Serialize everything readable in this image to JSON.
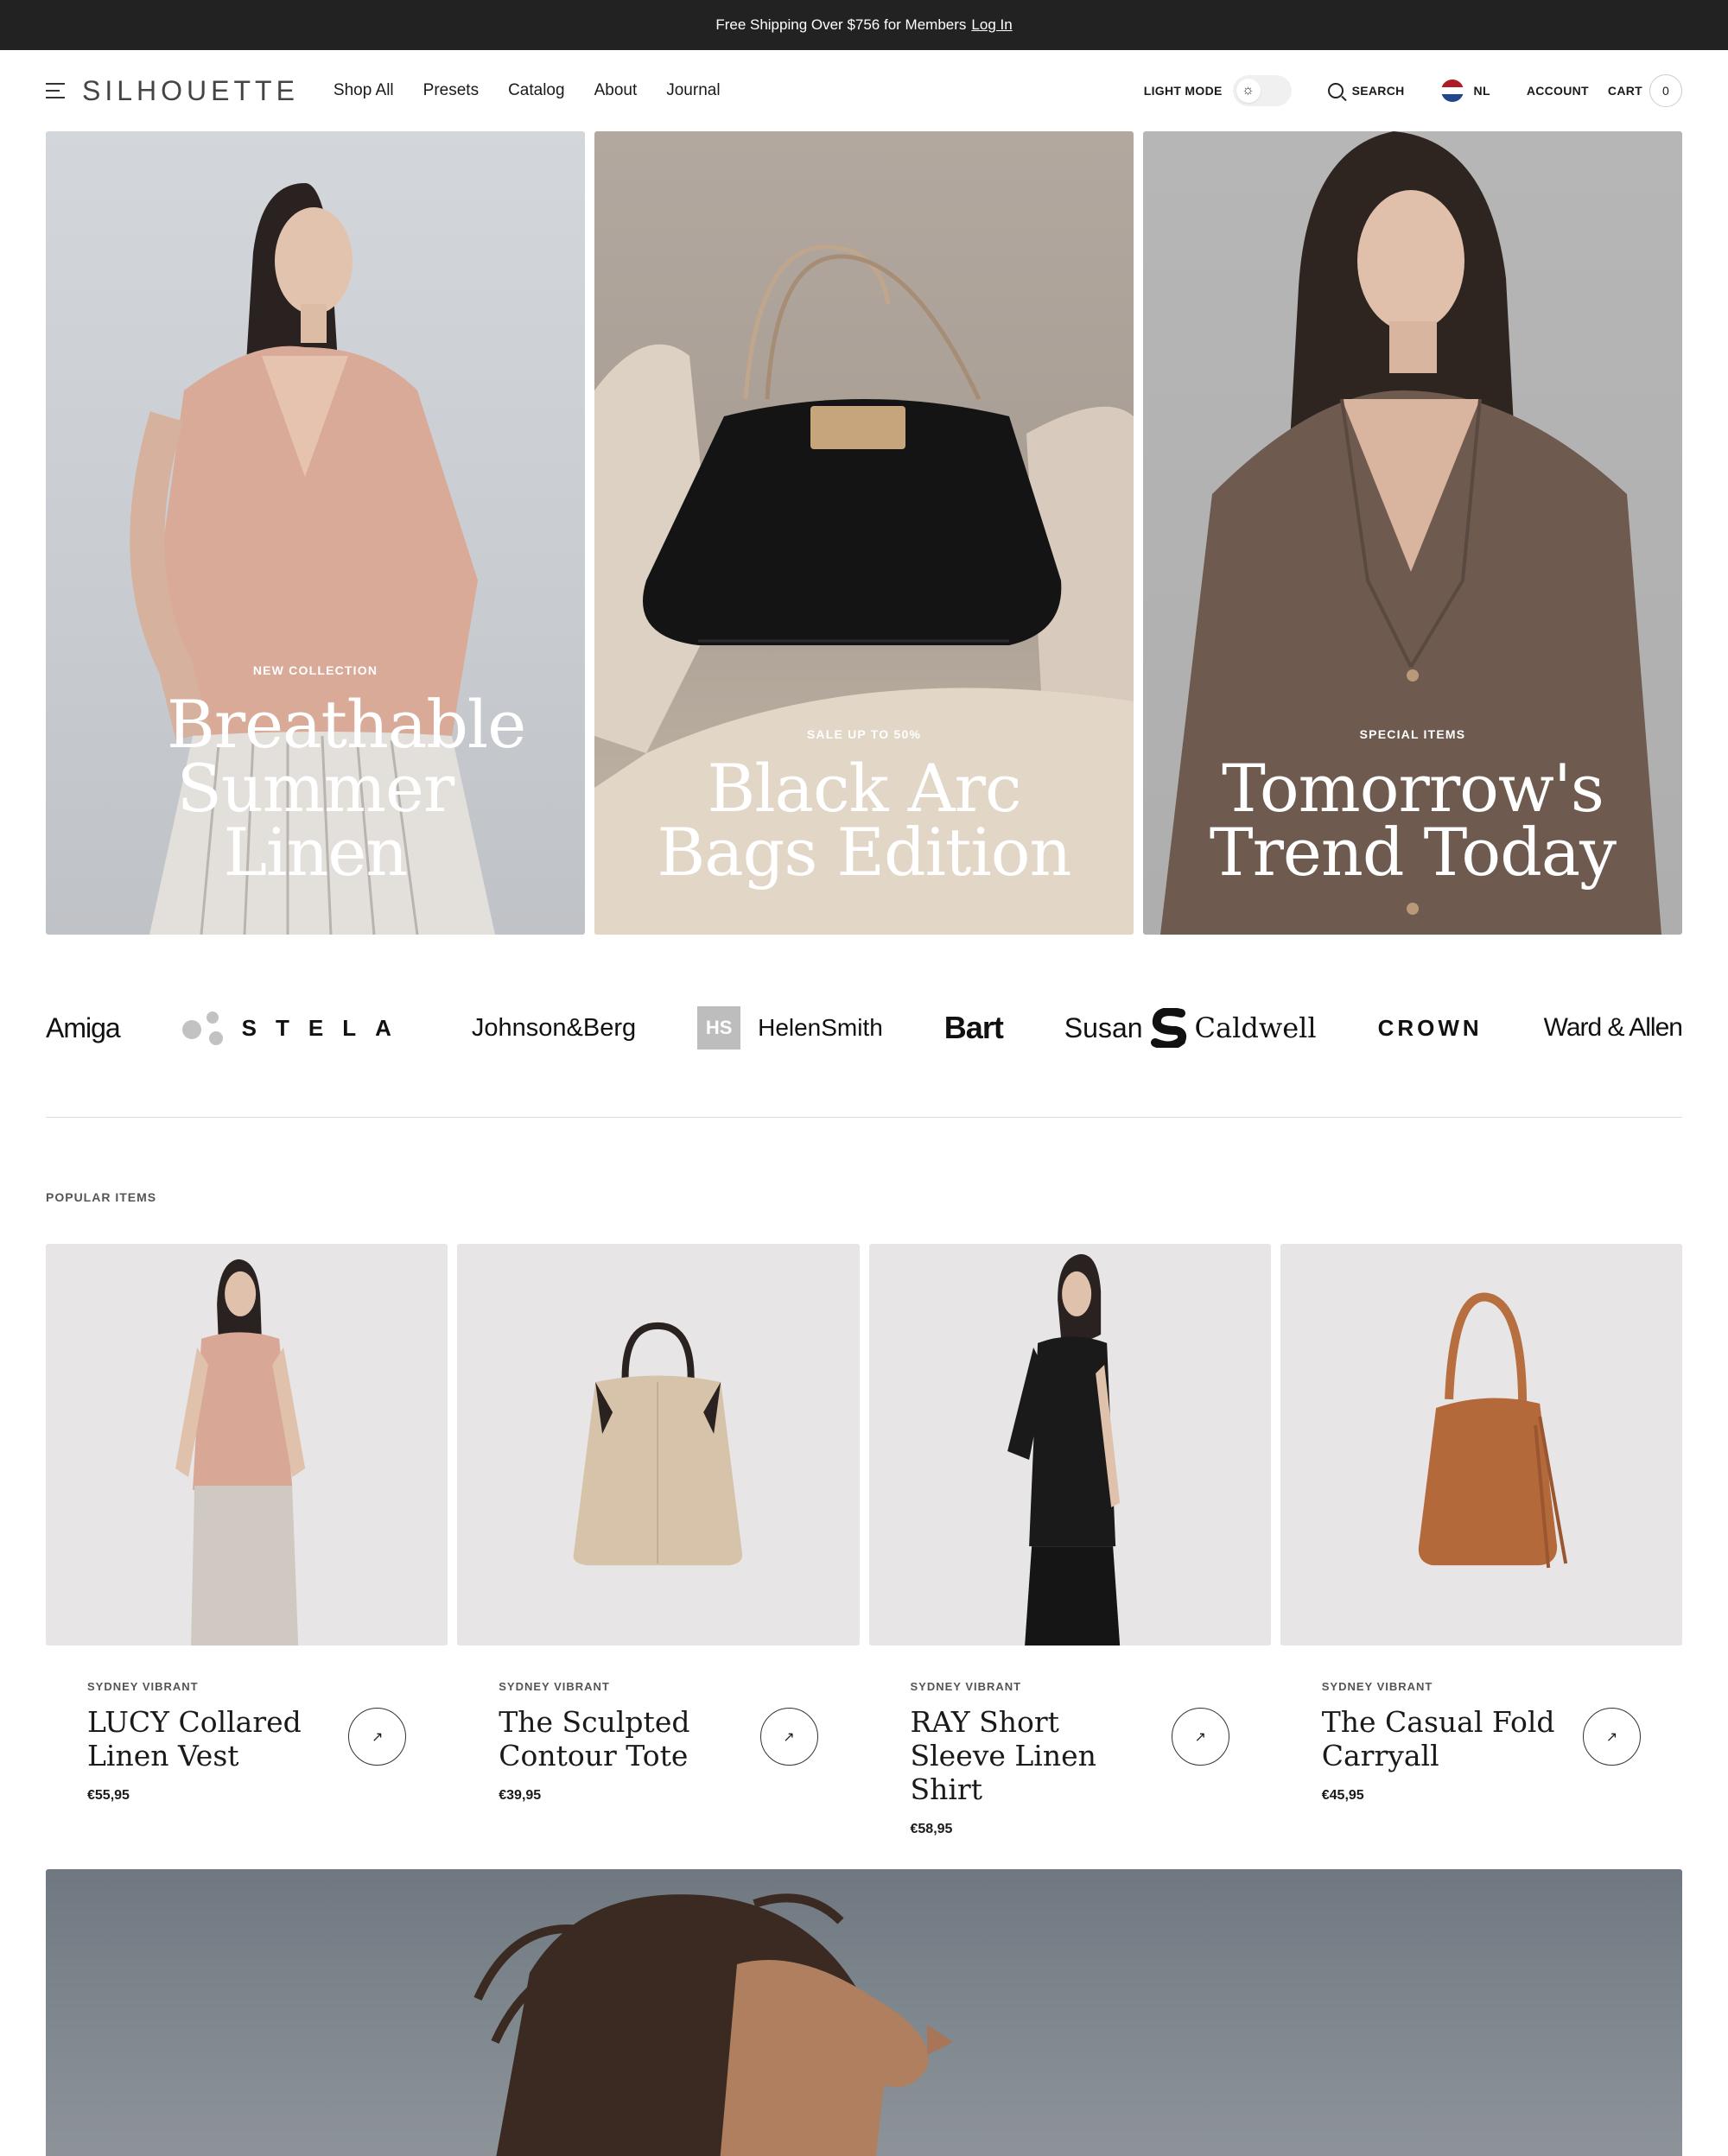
{
  "announcement": {
    "text": "Free Shipping Over $756 for Members",
    "link": "Log In"
  },
  "header": {
    "logo": "SILHOUETTE",
    "nav": [
      "Shop All",
      "Presets",
      "Catalog",
      "About",
      "Journal"
    ],
    "light_mode_label": "LIGHT MODE",
    "search_label": "SEARCH",
    "language": "NL",
    "account_label": "ACCOUNT",
    "cart_label": "CART",
    "cart_count": "0"
  },
  "hero": [
    {
      "eyebrow": "NEW COLLECTION",
      "headline": "Breathable Summer Linen"
    },
    {
      "eyebrow": "SALE UP TO 50%",
      "headline": "Black Arc Bags Edition"
    },
    {
      "eyebrow": "SPECIAL ITEMS",
      "headline": "Tomorrow's Trend Today"
    }
  ],
  "brands": [
    "Amiga",
    "STELA",
    "Johnson&Berg",
    "HS",
    "HelenSmith",
    "Bart",
    "Susan",
    "Caldwell",
    "CROWN",
    "Ward & Allen"
  ],
  "popular": {
    "label": "POPULAR ITEMS",
    "items": [
      {
        "vendor": "SYDNEY VIBRANT",
        "title": "LUCY Collared Linen Vest",
        "price": "€55,95"
      },
      {
        "vendor": "SYDNEY VIBRANT",
        "title": "The Sculpted Contour Tote",
        "price": "€39,95"
      },
      {
        "vendor": "SYDNEY VIBRANT",
        "title": "RAY Short Sleeve Linen Shirt",
        "price": "€58,95"
      },
      {
        "vendor": "SYDNEY VIBRANT",
        "title": "The Casual Fold Carryall",
        "price": "€45,95"
      }
    ]
  },
  "icons": {
    "menu": "hamburger-icon",
    "theme": "sun-icon",
    "search": "search-icon",
    "flag": "netherlands-flag-icon",
    "arrow": "arrow-up-right-icon"
  },
  "colors": {
    "announce_bg": "#222222",
    "card_bg": "#e7e5e6",
    "flag_red": "#ae1c28",
    "flag_blue": "#21468b"
  }
}
